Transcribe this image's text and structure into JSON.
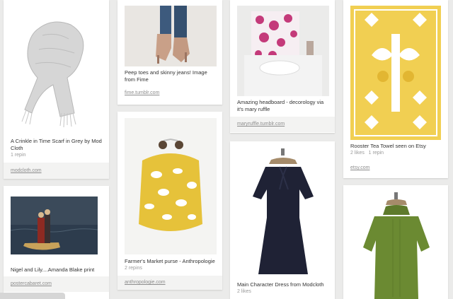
{
  "pins": [
    {
      "id": "scarf",
      "description": "A Crinkle in Time Scarf in Grey by Mod Cloth",
      "stats": "1 repin",
      "source": "modcloth.com",
      "image": "grey-scarf-image"
    },
    {
      "id": "ship",
      "description": "Nigel and Lily....Amanda Blake print",
      "stats": "",
      "source": "postercabaret.com",
      "image": "ship-print-image"
    },
    {
      "id": "shoes",
      "description": "Peep toes and skinny jeans! Image from Fime",
      "stats": "",
      "source": "fime.tumblr.com",
      "image": "peep-toe-shoes-image"
    },
    {
      "id": "purse",
      "description": "Farmer's Market purse - Anthropologie",
      "stats": "2 repins",
      "source": "anthropologie.com",
      "image": "yellow-purse-image"
    },
    {
      "id": "headboard",
      "description": "Amazing headboard - decorology via it's mary ruffle",
      "stats": "",
      "source": "maryruffle.tumblr.com",
      "image": "headboard-image"
    },
    {
      "id": "dress",
      "description": "Main Character Dress from Modcloth",
      "stats": "2 likes",
      "source": "",
      "image": "navy-dress-image"
    },
    {
      "id": "towel",
      "description": "Rooster Tea Towel seen on Etsy",
      "stats": "2 likes   1 repin",
      "source": "etsy.com",
      "image": "rooster-towel-image"
    },
    {
      "id": "green",
      "description": "",
      "stats": "",
      "source": "",
      "image": "green-sweater-dress-image"
    }
  ]
}
